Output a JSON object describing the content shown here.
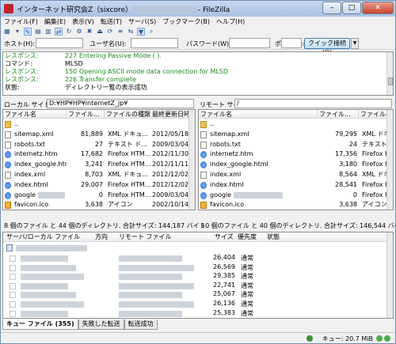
{
  "window": {
    "title_prefix": "インターネット研究会Z（sixcore）",
    "title_suffix": " - FileZilla",
    "buttons": [
      "–",
      "□",
      "✕"
    ]
  },
  "menu": [
    "ファイル(F)",
    "編集(E)",
    "表示(V)",
    "転送(T)",
    "サーバ(S)",
    "ブックマーク(B)",
    "ヘルプ(H)"
  ],
  "quickconnect": {
    "host_label": "ホスト(H):",
    "user_label": "ユーザ名(U):",
    "pass_label": "パスワード(W):",
    "port_label": "ポート(P):",
    "button": "クイック接続(Q)"
  },
  "log": [
    {
      "type": "レスポンス:",
      "msg": "227 Entering Passive Mode (                    ).",
      "color": "green"
    },
    {
      "type": "コマンド:",
      "msg": "MLSD",
      "color": "black"
    },
    {
      "type": "レスポンス:",
      "msg": "150 Opening ASCII mode data connection for MLSD",
      "color": "green"
    },
    {
      "type": "レスポンス:",
      "msg": "226 Transfer complete",
      "color": "green"
    },
    {
      "type": "状態:",
      "msg": "ディレクトリ一覧の表示成功",
      "color": "black"
    }
  ],
  "local": {
    "site_label": "ローカル サイト:",
    "path": "D:¥HP¥HP¥internetZ_jp¥",
    "columns": [
      "ファイル名",
      "ファイル...",
      "ファイルの種類",
      "最終更新日時"
    ],
    "files": [
      {
        "name": "..",
        "size": "",
        "type": "",
        "date": "",
        "icon": "folder"
      },
      {
        "name": "sitemap.xml",
        "size": "81,889",
        "type": "XML ドキュ...",
        "date": "2012/05/18",
        "icon": "doc"
      },
      {
        "name": "robots.txt",
        "size": "27",
        "type": "テキスト ド...",
        "date": "2009/03/04",
        "icon": "doc"
      },
      {
        "name": "internetz.htm",
        "size": "17,682",
        "type": "Firefox HTM...",
        "date": "2012/11/30",
        "icon": "ie"
      },
      {
        "name": "index_google.html",
        "size": "3,241",
        "type": "Firefox HTM...",
        "date": "2012/11/11",
        "icon": "ie"
      },
      {
        "name": "index.xml",
        "size": "8,703",
        "type": "XML ドキュ...",
        "date": "2012/12/02",
        "icon": "doc"
      },
      {
        "name": "index.html",
        "size": "29,007",
        "type": "Firefox HTM...",
        "date": "2012/12/02",
        "icon": "ie"
      },
      {
        "name": "google",
        "size": "0",
        "type": "Firefox HTM...",
        "date": "2009/03/04",
        "icon": "ie"
      },
      {
        "name": "favicon.ico",
        "size": "3,638",
        "type": "アイコン",
        "date": "2002/10/14",
        "icon": "ico"
      }
    ],
    "status": "8 個のファイル と 44 個のディレクトリ. 合計サイズ: 144,187 バイト"
  },
  "remote": {
    "site_label": "リモート サイト:",
    "path": "/",
    "columns": [
      "ファイル名",
      "ファイル...",
      "ファイルの...",
      "最"
    ],
    "files": [
      {
        "name": "..",
        "size": "",
        "type": "",
        "date": "",
        "icon": "folder"
      },
      {
        "name": "sitemap.xml",
        "size": "79,295",
        "type": "XML ドキ...",
        "date": "20",
        "icon": "doc"
      },
      {
        "name": "robots.txt",
        "size": "24",
        "type": "テキスト ...",
        "date": "20",
        "icon": "doc"
      },
      {
        "name": "internetz.htm",
        "size": "17,356",
        "type": "Firefox H...",
        "date": "20",
        "icon": "ie"
      },
      {
        "name": "index_google.html",
        "size": "3,180",
        "type": "Firefox H...",
        "date": "20",
        "icon": "ie"
      },
      {
        "name": "index.xml",
        "size": "8,564",
        "type": "XML ドキ...",
        "date": "20",
        "icon": "doc"
      },
      {
        "name": "index.html",
        "size": "28,541",
        "type": "Firefox H...",
        "date": "20",
        "icon": "ie"
      },
      {
        "name": "google                              .html",
        "size": "0",
        "type": "Firefox H...",
        "date": "20",
        "icon": "ie"
      },
      {
        "name": "favicon.ico",
        "size": "3,638",
        "type": "アイコン",
        "date": "20",
        "icon": "ico"
      }
    ],
    "status": "10 個のファイル と 40 個のディレクトリ. 合計サイズ: 146,544 バイト"
  },
  "queue": {
    "columns": [
      "サーバ/ローカル ファイル",
      "方向",
      "リモート ファイル",
      "サイズ",
      "優先度",
      "状態"
    ],
    "rows": [
      {
        "size": "26,404",
        "prio": "通常"
      },
      {
        "size": "26,569",
        "prio": "通常"
      },
      {
        "size": "29,385",
        "prio": "通常"
      },
      {
        "size": "22,741",
        "prio": "通常"
      },
      {
        "size": "25,067",
        "prio": "通常"
      },
      {
        "size": "26,136",
        "prio": "通常"
      },
      {
        "size": "25,383",
        "prio": "通常"
      }
    ]
  },
  "tabs": [
    "キュー ファイル (355)",
    "失敗した転送",
    "転送成功"
  ],
  "statusbar": {
    "queue": "キュー: 20.7 MiB"
  }
}
